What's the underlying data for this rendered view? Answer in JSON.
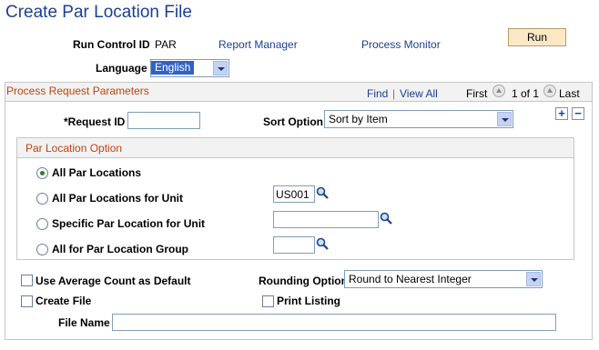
{
  "page": {
    "title": "Create Par Location File"
  },
  "header": {
    "run_control_label": "Run Control ID",
    "run_control_value": "PAR",
    "report_manager": "Report Manager",
    "process_monitor": "Process Monitor",
    "run_button": "Run",
    "language_label": "Language",
    "language_value": "English"
  },
  "params": {
    "title": "Process Request Parameters",
    "find": "Find",
    "separator": "|",
    "view_all": "View All",
    "first": "First",
    "pager": "1 of 1",
    "last": "Last",
    "request_id_label": "*Request ID",
    "request_id_value": "",
    "sort_option_label": "Sort Option",
    "sort_option_value": "Sort by Item",
    "add_symbol": "+",
    "remove_symbol": "−"
  },
  "par_location": {
    "title": "Par Location Option",
    "options": [
      {
        "label": "All Par Locations",
        "selected": true
      },
      {
        "label": "All Par Locations for Unit",
        "selected": false,
        "field_value": "US001"
      },
      {
        "label": "Specific Par Location for Unit",
        "selected": false,
        "field_value": ""
      },
      {
        "label": "All for Par Location Group",
        "selected": false,
        "field_value": ""
      }
    ]
  },
  "bottom": {
    "use_avg_label": "Use Average Count as Default",
    "use_avg_checked": false,
    "rounding_label": "Rounding Option",
    "rounding_value": "Round to Nearest Integer",
    "create_file_label": "Create File",
    "create_file_checked": false,
    "print_listing_label": "Print Listing",
    "print_listing_checked": false,
    "file_name_label": "File Name",
    "file_name_value": ""
  },
  "colors": {
    "title": "#1c3f94",
    "group_title": "#c0440a",
    "run_button_bg": "#fbe8c5",
    "selected_language_bg": "#3162c5"
  },
  "icons": [
    "lookup-icon",
    "add-row-icon",
    "delete-row-icon",
    "previous-icon",
    "next-icon",
    "dropdown-arrow-icon"
  ]
}
